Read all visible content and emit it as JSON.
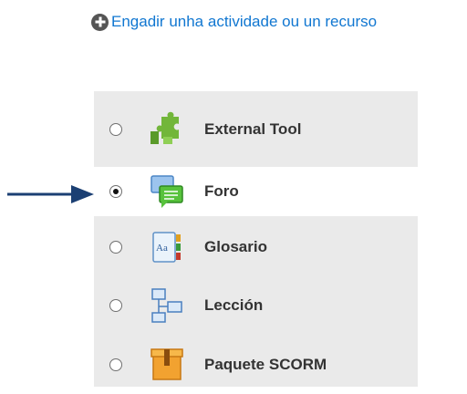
{
  "add_activity": {
    "label": "Engadir unha actividade ou un recurso",
    "icon": "plus-circle-icon"
  },
  "colors": {
    "link": "#1177d1",
    "arrow": "#1b3f73",
    "list_background": "#eaeaea",
    "selected_background": "#ffffff"
  },
  "activities": [
    {
      "label": "External Tool",
      "icon": "puzzle-piece-icon",
      "selected": false
    },
    {
      "label": "Foro",
      "icon": "forum-speech-bubbles-icon",
      "selected": true
    },
    {
      "label": "Glosario",
      "icon": "glossary-book-icon",
      "selected": false
    },
    {
      "label": "Lección",
      "icon": "lesson-flowchart-icon",
      "selected": false
    },
    {
      "label": "Paquete SCORM",
      "icon": "scorm-package-box-icon",
      "selected": false
    }
  ]
}
